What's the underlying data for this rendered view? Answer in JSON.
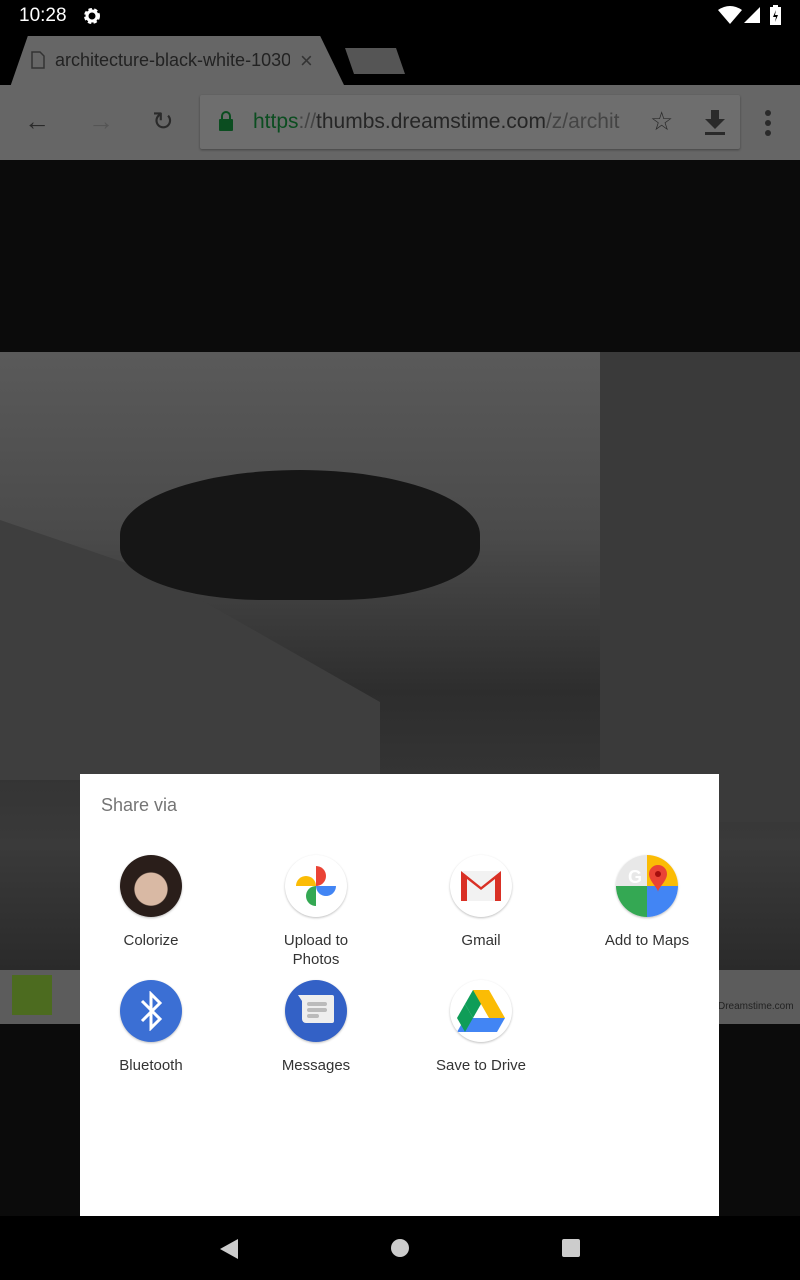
{
  "status_bar": {
    "time": "10:28",
    "icons": [
      "settings-icon",
      "wifi-icon",
      "signal-icon",
      "battery-charging-icon"
    ]
  },
  "browser": {
    "tab": {
      "title": "architecture-black-white-1030",
      "close": "×"
    },
    "url": {
      "scheme": "https",
      "separator": "://",
      "host": "thumbs.dreamstime.com",
      "path": "/z/archit"
    }
  },
  "page": {
    "ad_site": "Dreamstime.com"
  },
  "share_dialog": {
    "title": "Share via",
    "apps": [
      {
        "label": "Colorize",
        "icon": "colorize-icon"
      },
      {
        "label": "Upload to Photos",
        "icon": "google-photos-icon"
      },
      {
        "label": "Gmail",
        "icon": "gmail-icon"
      },
      {
        "label": "Add to Maps",
        "icon": "google-maps-icon"
      },
      {
        "label": "Bluetooth",
        "icon": "bluetooth-icon"
      },
      {
        "label": "Messages",
        "icon": "messages-icon"
      },
      {
        "label": "Save to Drive",
        "icon": "google-drive-icon"
      }
    ]
  },
  "colors": {
    "scrim": "#000000",
    "dialog": "#ffffff",
    "secure_green": "#0b8043",
    "bluetooth": "#3b6fd4"
  }
}
